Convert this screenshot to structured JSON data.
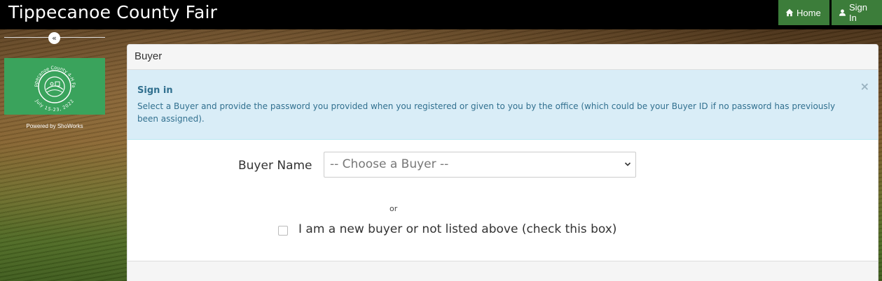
{
  "navbar": {
    "brand": "Tippecanoe County Fair",
    "home_label": "Home",
    "signin_label": "Sign In"
  },
  "sidebar": {
    "collapse_glyph": "«",
    "logo_top_text": "Tippecanoe County 4-H Fair",
    "logo_bottom_text": "July 15-23, 2022",
    "powered_by": "Powered by ShoWorks"
  },
  "panel": {
    "heading": "Buyer",
    "alert": {
      "title": "Sign in",
      "text": "Select a Buyer and provide the password you provided when you registered or given to you by the office (which could be your Buyer ID if no password has previously been assigned).",
      "close": "×"
    },
    "form": {
      "buyer_label": "Buyer Name",
      "buyer_select_value": "-- Choose a Buyer --",
      "or_text": "or",
      "new_buyer_label": "I am a new buyer or not listed above (check this box)"
    }
  },
  "colors": {
    "navbar_bg": "#000000",
    "nav_button_bg": "#3c7d3a",
    "logo_bg": "#3aa35c",
    "alert_bg": "#d9edf7",
    "alert_text": "#31708f"
  }
}
